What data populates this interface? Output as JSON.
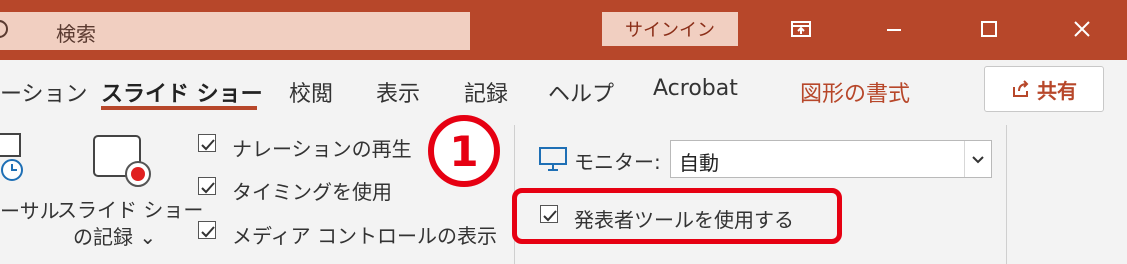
{
  "titlebar": {
    "search_placeholder": "検索",
    "signin_label": "サインイン",
    "accent_color": "#b7472a"
  },
  "ribbon": {
    "tabs": [
      {
        "label": "ーション"
      },
      {
        "label": "スライド ショー",
        "active": true
      },
      {
        "label": "校閲"
      },
      {
        "label": "表示"
      },
      {
        "label": "記録"
      },
      {
        "label": "ヘルプ"
      },
      {
        "label": "Acrobat"
      },
      {
        "label": "図形の書式"
      }
    ],
    "share_label": "共有"
  },
  "commands": {
    "rehearse_label": "ーサル",
    "record_label_line1": "スライド ショー",
    "record_label_line2": "の記録 ⌄",
    "checkboxes": [
      {
        "label": "ナレーションの再生",
        "checked": true
      },
      {
        "label": "タイミングを使用",
        "checked": true
      },
      {
        "label": "メディア コントロールの表示",
        "checked": true
      }
    ],
    "monitor_label": "モニター:",
    "monitor_value": "自動",
    "presenter_view_label": "発表者ツールを使用する",
    "presenter_view_checked": true
  },
  "annotation": {
    "step_number": "1",
    "highlight_color": "#e60012"
  }
}
